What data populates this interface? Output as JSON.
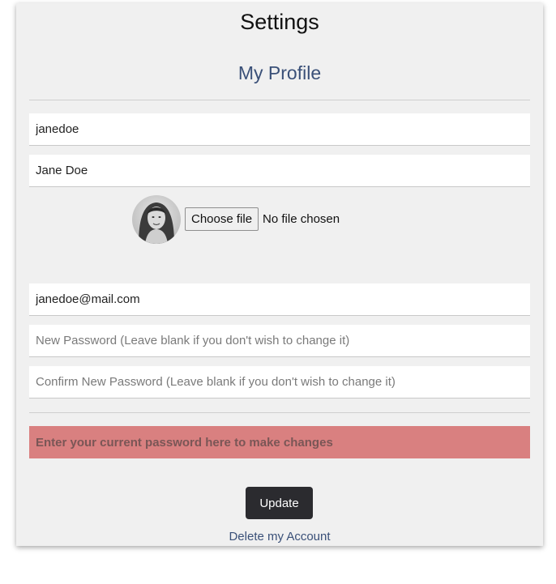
{
  "header": {
    "title": "Settings",
    "subtitle": "My Profile"
  },
  "form": {
    "username_value": "janedoe",
    "fullname_value": "Jane Doe",
    "avatar_icon": "user-photo-avatar",
    "choose_file_label": "Choose file",
    "no_file_text": "No file chosen",
    "email_value": "janedoe@mail.com",
    "new_password_placeholder": "New Password (Leave blank if you don't wish to change it)",
    "confirm_password_placeholder": "Confirm New Password (Leave blank if you don't wish to change it)",
    "current_password_placeholder": "Enter your current password here to make changes"
  },
  "actions": {
    "update_label": "Update",
    "delete_label": "Delete my Account"
  },
  "colors": {
    "card_background": "#f0f0f0",
    "accent_text": "#3a5078",
    "current_password_background": "#d98080",
    "update_button_background": "#2b2b2f"
  }
}
